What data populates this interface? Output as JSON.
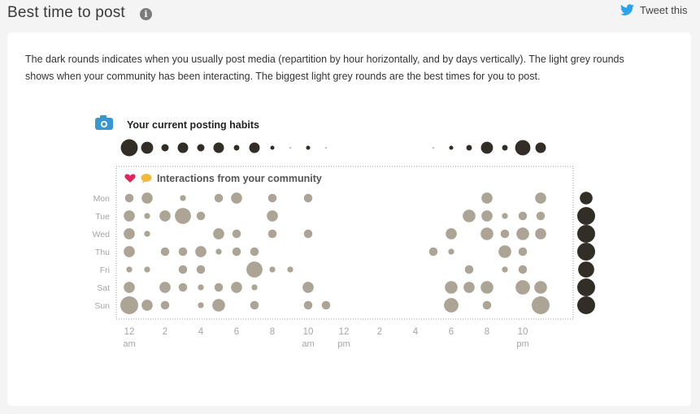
{
  "header": {
    "title": "Best time to post",
    "info_icon": "info-icon",
    "tweet_label": "Tweet this",
    "tweet_icon": "twitter-bird-icon"
  },
  "description": "The dark rounds indicates when you usually post media (repartition by hour horizontally, and by days vertically). The light grey rounds shows when your community has been interacting. The biggest light grey rounds are the best times for you to post.",
  "colors": {
    "posting": "#322e27",
    "community": "#aca596",
    "camera": "#3a96d0",
    "heart": "#e0245e",
    "bubble": "#f0b93a",
    "twitter": "#2aa3ef",
    "label": "#a5a5a5"
  },
  "chart_data": {
    "type": "scatter",
    "subtype": "punchcard",
    "posting_title": "Your current posting habits",
    "posting_icon": "camera-icon",
    "community_title": "Interactions from your community",
    "community_icons": [
      "heart-icon",
      "speech-bubble-icon"
    ],
    "days": [
      "Mon",
      "Tue",
      "Wed",
      "Thu",
      "Fri",
      "Sat",
      "Sun"
    ],
    "hours": 24,
    "x_tick_labels": [
      {
        "hour": 0,
        "label": "12",
        "sub": "am"
      },
      {
        "hour": 2,
        "label": "2",
        "sub": ""
      },
      {
        "hour": 4,
        "label": "4",
        "sub": ""
      },
      {
        "hour": 6,
        "label": "6",
        "sub": ""
      },
      {
        "hour": 8,
        "label": "8",
        "sub": ""
      },
      {
        "hour": 10,
        "label": "10",
        "sub": "am"
      },
      {
        "hour": 12,
        "label": "12",
        "sub": "pm"
      },
      {
        "hour": 14,
        "label": "2",
        "sub": ""
      },
      {
        "hour": 16,
        "label": "4",
        "sub": ""
      },
      {
        "hour": 18,
        "label": "6",
        "sub": ""
      },
      {
        "hour": 20,
        "label": "8",
        "sub": ""
      },
      {
        "hour": 22,
        "label": "10",
        "sub": "pm"
      }
    ],
    "posting_by_hour": [
      1.0,
      0.71,
      0.43,
      0.62,
      0.43,
      0.62,
      0.33,
      0.62,
      0.24,
      0.05,
      0.24,
      0.05,
      0,
      0,
      0,
      0,
      0,
      0.05,
      0.24,
      0.33,
      0.71,
      0.33,
      0.9,
      0.62
    ],
    "posting_by_day": [
      0.71,
      1.0,
      1.0,
      1.0,
      0.9,
      1.0,
      1.0
    ],
    "community": [
      [
        0.48,
        0.62,
        0,
        0.33,
        0,
        0.48,
        0.62,
        0,
        0.48,
        0,
        0.48,
        0,
        0,
        0,
        0,
        0,
        0,
        0,
        0,
        0,
        0.62,
        0,
        0,
        0.62
      ],
      [
        0.62,
        0.33,
        0.62,
        0.9,
        0.48,
        0,
        0,
        0,
        0.62,
        0,
        0,
        0,
        0,
        0,
        0,
        0,
        0,
        0,
        0,
        0.71,
        0.62,
        0.33,
        0.48,
        0.48
      ],
      [
        0.62,
        0.33,
        0,
        0,
        0,
        0.62,
        0.48,
        0,
        0.48,
        0,
        0.48,
        0,
        0,
        0,
        0,
        0,
        0,
        0,
        0.62,
        0,
        0.71,
        0.48,
        0.71,
        0.62
      ],
      [
        0.62,
        0,
        0.48,
        0.48,
        0.62,
        0.33,
        0.48,
        0.48,
        0,
        0,
        0,
        0,
        0,
        0,
        0,
        0,
        0,
        0.48,
        0.33,
        0,
        0,
        0.71,
        0.48,
        0
      ],
      [
        0.33,
        0.33,
        0,
        0.48,
        0.48,
        0,
        0,
        0.9,
        0.33,
        0.33,
        0,
        0,
        0,
        0,
        0,
        0,
        0,
        0,
        0,
        0.48,
        0,
        0.33,
        0.48,
        0
      ],
      [
        0.62,
        0,
        0.62,
        0.48,
        0.33,
        0.48,
        0.62,
        0.33,
        0,
        0,
        0.62,
        0,
        0,
        0,
        0,
        0,
        0,
        0,
        0.71,
        0.62,
        0.71,
        0,
        0.81,
        0.71
      ],
      [
        1.0,
        0.62,
        0.48,
        0,
        0.33,
        0.71,
        0,
        0.48,
        0,
        0,
        0.48,
        0.48,
        0,
        0,
        0,
        0,
        0,
        0,
        0.81,
        0,
        0.48,
        0,
        0,
        1.0
      ]
    ],
    "grid": false
  }
}
